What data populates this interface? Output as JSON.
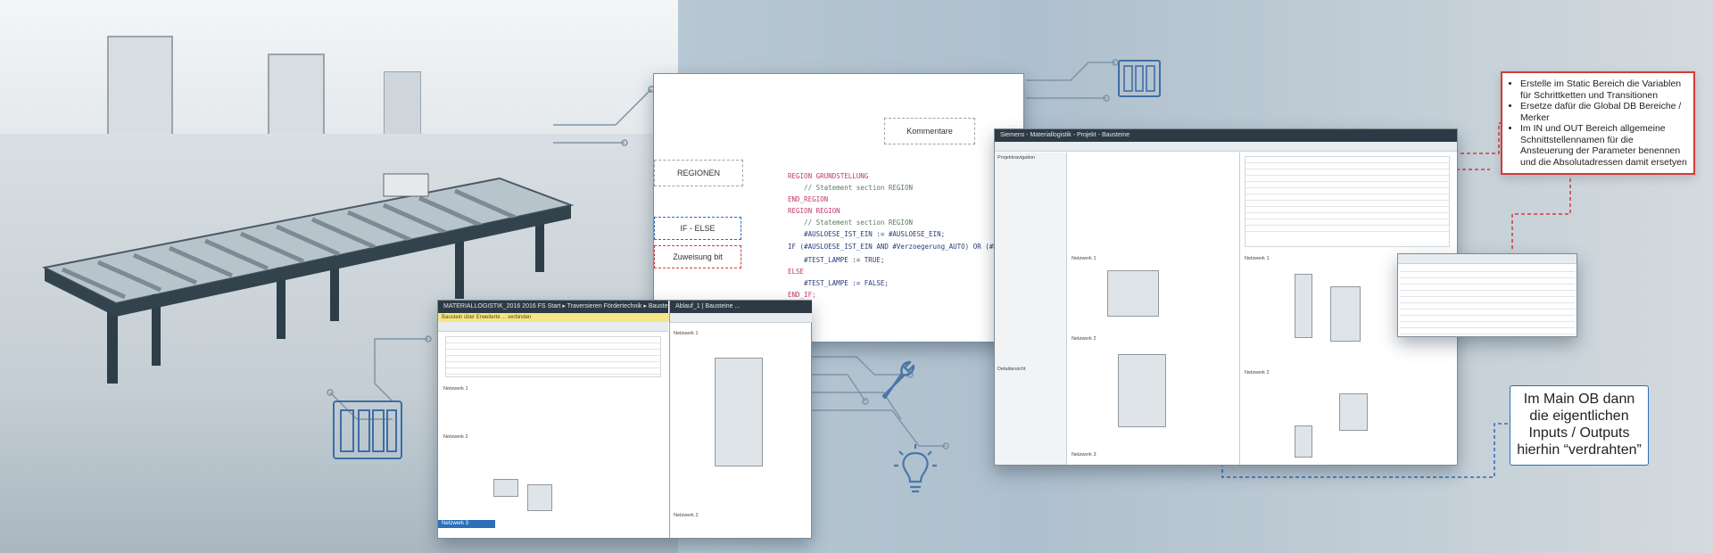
{
  "left_window": {
    "title": "MATERIALLOGISTIK_2016 2016 FS Start  ▸  Traversieren Fördertechnik  ▸  Bausteine  ▸  ...",
    "banner": "Baustein über Erweiterte ... verbinden",
    "section_1": "Netzwerk 1",
    "section_2": "Netzwerk 2",
    "section_3": "Netzwerk 3"
  },
  "left_window_right": {
    "title": "Ablauf_1 | Bausteine  ...",
    "section_1": "Netzwerk 1",
    "section_2": "Netzwerk 2"
  },
  "code_window": {
    "labels": {
      "kommentare": "Kommentare",
      "regionen": "REGIONEN",
      "if_else": "IF - ELSE",
      "zuweisung": "Zuweisung bit"
    },
    "code_lines": [
      "REGION GRUNDSTELLUNG",
      "    // Statement section REGION",
      "END_REGION",
      "REGION REGION",
      "    // Statement section REGION",
      "    #AUSLOESE_IST_EIN := #AUSLOESE_EIN;",
      "IF (#AUSLOESE_IST_EIN AND #Verzoegerung_AUTO) OR (#Hand_E",
      "    #TEST_LAMPE := TRUE;",
      "ELSE",
      "    #TEST_LAMPE := FALSE;",
      "END_IF;"
    ]
  },
  "right_window": {
    "title": "Siemens  -  Materiallogistik  -  Projekt  -  Bausteine",
    "panel_left_title": "Projektnavigation",
    "panel_left_bottom": "Detailansicht",
    "network_1": "Netzwerk 1",
    "network_2": "Netzwerk 2",
    "network_3": "Netzwerk 3",
    "right_net_1": "Netzwerk 1",
    "right_net_2": "Netzwerk 2"
  },
  "callout_red": {
    "items": [
      "Erstelle im Static Bereich die Variablen für Schrittketten und Transitionen",
      "Ersetze dafür die Global DB Bereiche / Merker",
      "Im IN  und OUT Bereich allgemeine Schnittstellennamen für die Ansteuerung der Parameter benennen und die Absolutadressen damit ersetyen"
    ]
  },
  "callout_blue": {
    "lines": [
      "Im Main OB dann",
      "die eigentlichen",
      "Inputs / Outputs",
      "hierhin “verdrahten”"
    ]
  },
  "icons": [
    "plc-icon",
    "plc-icon-top",
    "wrench-icon",
    "lightbulb-icon"
  ],
  "colors": {
    "accent_blue": "#2b6fb8",
    "callout_red": "#d43a3a",
    "trace": "#7f95a6"
  }
}
